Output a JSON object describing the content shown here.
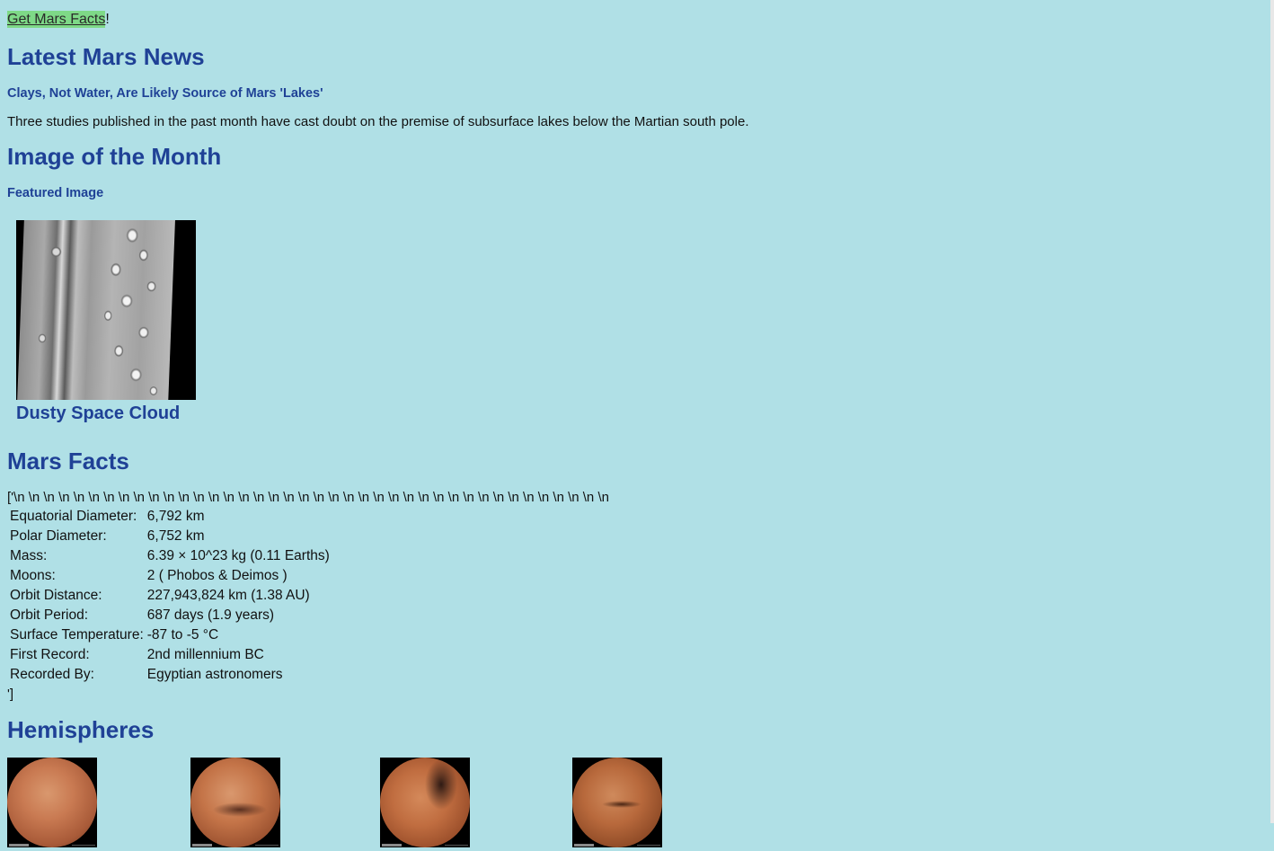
{
  "top_button": {
    "label": "Get Mars Facts",
    "suffix": "!"
  },
  "news": {
    "heading": "Latest Mars News",
    "title": "Clays, Not Water, Are Likely Source of Mars 'Lakes'",
    "teaser": "Three studies published in the past month have cast doubt on the premise of subsurface lakes below the Martian south pole."
  },
  "image_of_month": {
    "heading": "Image of the Month",
    "subheading": "Featured Image",
    "caption": "Dusty Space Cloud"
  },
  "facts": {
    "heading": "Mars Facts",
    "raw_prefix": "['\\n \\n \\n \\n \\n \\n \\n \\n \\n \\n \\n \\n \\n \\n \\n \\n \\n \\n \\n \\n \\n \\n \\n \\n \\n \\n \\n \\n \\n \\n \\n \\n \\n \\n \\n \\n \\n \\n \\n \\n",
    "raw_suffix": "']",
    "rows": [
      {
        "label": "Equatorial Diameter:",
        "value": "6,792 km"
      },
      {
        "label": "Polar Diameter:",
        "value": "6,752 km"
      },
      {
        "label": "Mass:",
        "value": "6.39 × 10^23 kg (0.11 Earths)"
      },
      {
        "label": "Moons:",
        "value": "2 ( Phobos & Deimos )"
      },
      {
        "label": "Orbit Distance:",
        "value": "227,943,824 km (1.38 AU)"
      },
      {
        "label": "Orbit Period:",
        "value": "687 days (1.9 years)"
      },
      {
        "label": "Surface Temperature:",
        "value": "-87 to -5 °C"
      },
      {
        "label": "First Record:",
        "value": "2nd millennium BC"
      },
      {
        "label": "Recorded By:",
        "value": "Egyptian astronomers"
      }
    ]
  },
  "hemispheres": {
    "heading": "Hemispheres",
    "images": [
      {
        "name": "hemisphere-1"
      },
      {
        "name": "hemisphere-2"
      },
      {
        "name": "hemisphere-3"
      },
      {
        "name": "hemisphere-4"
      }
    ]
  },
  "colors": {
    "background": "#b0e0e6",
    "heading": "#1f4196",
    "button": "#7ed987"
  }
}
